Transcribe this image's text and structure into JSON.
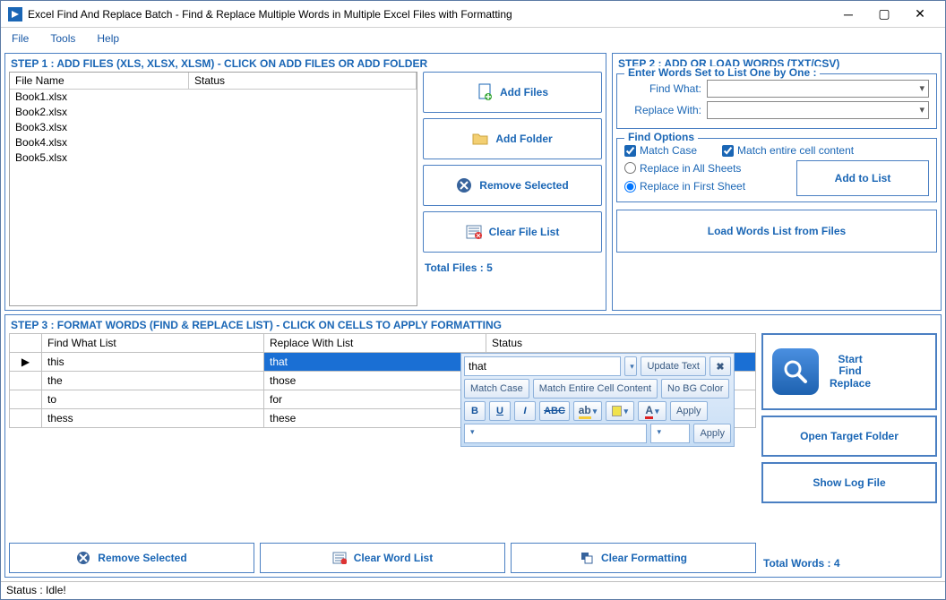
{
  "window": {
    "title": "Excel Find And Replace Batch - Find & Replace Multiple Words in Multiple Excel Files with Formatting"
  },
  "menu": {
    "file": "File",
    "tools": "Tools",
    "help": "Help"
  },
  "step1": {
    "title": "STEP 1 : ADD FILES (XLS, XLSX, XLSM) - CLICK ON ADD FILES OR ADD FOLDER",
    "col_filename": "File Name",
    "col_status": "Status",
    "files": [
      "Book1.xlsx",
      "Book2.xlsx",
      "Book3.xlsx",
      "Book4.xlsx",
      "Book5.xlsx"
    ],
    "btn_addfiles": "Add Files",
    "btn_addfolder": "Add Folder",
    "btn_remove": "Remove Selected",
    "btn_clear": "Clear File List",
    "total_label": "Total Files : 5"
  },
  "step2": {
    "title": "STEP 2 : ADD OR LOAD WORDS (TXT/CSV)",
    "enter_legend": "Enter Words Set to List One by One :",
    "find_what": "Find What:",
    "replace_with": "Replace With:",
    "find_options": "Find Options",
    "match_case": "Match Case",
    "match_entire": "Match entire cell content",
    "replace_all": "Replace in All Sheets",
    "replace_first": "Replace in First Sheet",
    "add_to_list": "Add to List",
    "load_words": "Load Words List from Files"
  },
  "step3": {
    "title": "STEP 3 : FORMAT WORDS (FIND & REPLACE LIST) - CLICK ON CELLS TO APPLY FORMATTING",
    "col_find": "Find What List",
    "col_replace": "Replace With List",
    "col_status": "Status",
    "rows": [
      {
        "find": "this",
        "replace": "that"
      },
      {
        "find": "the",
        "replace": "those"
      },
      {
        "find": "to",
        "replace": "for"
      },
      {
        "find": "thess",
        "replace": "these"
      }
    ],
    "toolbar": {
      "cell_value": "that",
      "update_text": "Update Text",
      "match_case": "Match Case",
      "match_entire": "Match Entire Cell Content",
      "no_bg": "No BG Color",
      "apply": "Apply",
      "b": "B",
      "u": "U",
      "i": "I",
      "abc": "ABC",
      "a": "A"
    },
    "btn_remove": "Remove Selected",
    "btn_clearword": "Clear Word List",
    "btn_clearfmt": "Clear Formatting"
  },
  "right": {
    "start1": "Start",
    "start2": "Find",
    "start3": "Replace",
    "open_target": "Open Target Folder",
    "show_log": "Show Log File",
    "total_words": "Total Words : 4"
  },
  "status": "Status  :  Idle!"
}
